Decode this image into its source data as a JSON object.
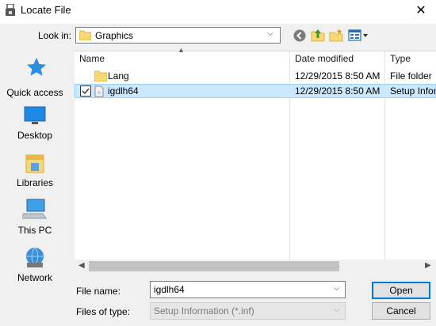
{
  "window": {
    "title": "Locate File",
    "close_glyph": "✕"
  },
  "look_in": {
    "label": "Look in:",
    "value": "Graphics"
  },
  "toolbar": {
    "icons": [
      "back-icon",
      "up-folder-icon",
      "new-folder-icon",
      "view-menu-icon"
    ]
  },
  "places": [
    {
      "label": "Quick access",
      "icon": "star-icon"
    },
    {
      "label": "Desktop",
      "icon": "desktop-icon"
    },
    {
      "label": "Libraries",
      "icon": "libraries-icon"
    },
    {
      "label": "This PC",
      "icon": "computer-icon"
    },
    {
      "label": "Network",
      "icon": "network-icon"
    }
  ],
  "list": {
    "columns": [
      "Name",
      "Date modified",
      "Type"
    ],
    "rows": [
      {
        "name": "Lang",
        "date": "12/29/2015 8:50 AM",
        "type": "File folder",
        "icon": "folder-icon",
        "selected": false
      },
      {
        "name": "igdlh64",
        "date": "12/29/2015 8:50 AM",
        "type": "Setup Infor",
        "icon": "setup-file-icon",
        "selected": true,
        "checked": true
      }
    ]
  },
  "file_name": {
    "label": "File name:",
    "value": "igdlh64"
  },
  "file_type": {
    "label": "Files of type:",
    "value": "Setup Information (*.inf)"
  },
  "buttons": {
    "open": "Open",
    "cancel": "Cancel"
  },
  "colors": {
    "selection": "#cce8ff",
    "selection_border": "#99d1ff",
    "accent": "#0078d7"
  }
}
